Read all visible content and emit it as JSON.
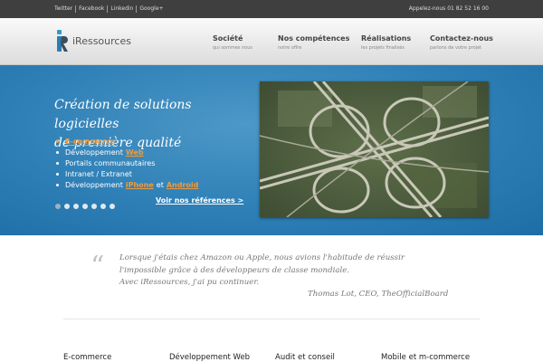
{
  "topbar": {
    "social_links": [
      "Twitter",
      "Facebook",
      "Linkedin",
      "Google+"
    ],
    "phone_text": "Appelez-nous 01 82 52 16 00"
  },
  "header": {
    "logo_text": "iRessources",
    "nav": [
      {
        "title": "Société",
        "subtitle": "qui sommes nous"
      },
      {
        "title": "Nos compétences",
        "subtitle": "notre offre"
      },
      {
        "title": "Réalisations",
        "subtitle": "les projets finalisés"
      },
      {
        "title": "Contactez-nous",
        "subtitle": "parlons de votre projet"
      }
    ]
  },
  "hero": {
    "title_line1": "Création de solutions logicielles",
    "title_line2": "de première qualité",
    "items": {
      "ecommerce": "E-commerce",
      "dev_web_prefix": "Développement",
      "dev_web_link": "Web",
      "portails": "Portails communautaires",
      "intranet": "Intranet / Extranet",
      "dev_mobile_prefix": "Développement",
      "iphone": "iPhone",
      "et": "et",
      "android": "Android"
    },
    "slide_count": 7,
    "active_slide": 1,
    "references_link": "Voir nos références >",
    "accent_color": "#f29b38",
    "background_color": "#2d7fb6"
  },
  "testimonial": {
    "quote_mark": "“",
    "line1": "Lorsque j'étais chez Amazon ou Apple, nous avions l'habitude de réussir",
    "line2": "l'impossible grâce à des développeurs de classe mondiale.",
    "line3": "Avec iRessources, j'ai pu continuer.",
    "author": "Thomas Lot, CEO, TheOfficialBoard"
  },
  "services": [
    "E-commerce",
    "Développement Web",
    "Audit et conseil",
    "Mobile et m-commerce"
  ]
}
